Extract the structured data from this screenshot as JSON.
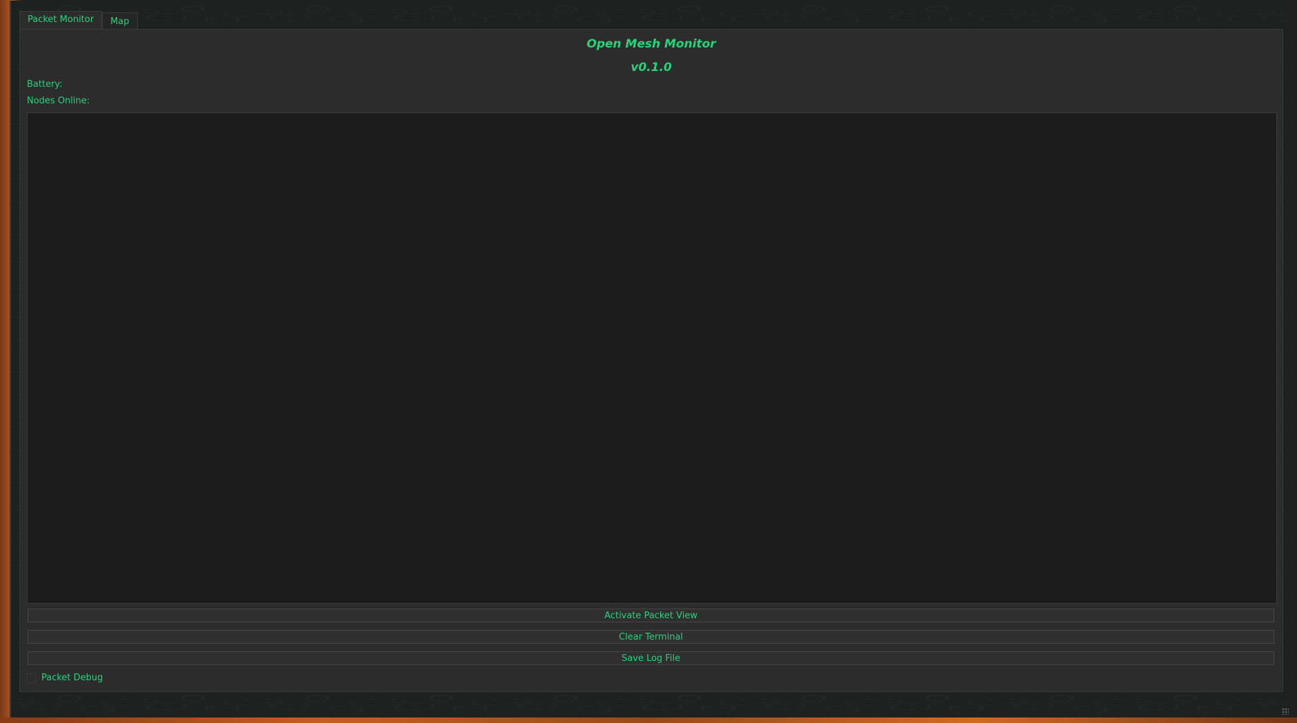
{
  "tabs": [
    {
      "label": "Packet Monitor",
      "active": true
    },
    {
      "label": "Map",
      "active": false
    }
  ],
  "header": {
    "title": "Open Mesh Monitor",
    "version": "v0.1.0"
  },
  "status": {
    "battery_label": "Battery:",
    "nodes_online_label": "Nodes Online:"
  },
  "buttons": {
    "activate": "Activate Packet View",
    "clear": "Clear Terminal",
    "save": "Save Log File"
  },
  "debug": {
    "label": "Packet Debug",
    "checked": false
  },
  "colors": {
    "accent": "#27d27a",
    "panel_bg": "#2c2c2c",
    "terminal_bg": "#1b1b1b"
  }
}
